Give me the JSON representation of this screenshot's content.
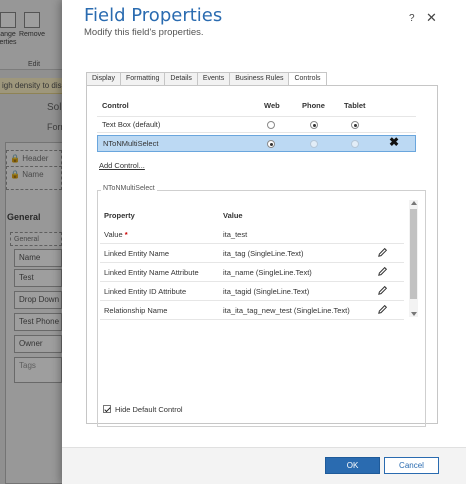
{
  "background": {
    "ribbon_buttons": [
      "ange\nerties",
      "Remove"
    ],
    "ribbon_group": "Edit",
    "warning": "igh density to disp",
    "title": "Solu",
    "subtitle": "Forr",
    "header_section": "Header",
    "header_field": "Name",
    "general": "General",
    "general_sub": "General",
    "fields": [
      "Name",
      "Test",
      "Drop Down",
      "Test Phone",
      "Owner"
    ],
    "tags": "Tags"
  },
  "dialog": {
    "title": "Field Properties",
    "subtitle": "Modify this field's properties.",
    "help": "?",
    "close": "✕"
  },
  "tabs": [
    "Display",
    "Formatting",
    "Details",
    "Events",
    "Business Rules",
    "Controls"
  ],
  "controls": {
    "headers": {
      "control": "Control",
      "web": "Web",
      "phone": "Phone",
      "tablet": "Tablet"
    },
    "rows": [
      {
        "name": "Text Box (default)",
        "web": false,
        "phone": true,
        "tablet": true
      },
      {
        "name": "NToNMultiSelect",
        "web": true,
        "phone": false,
        "tablet": false
      }
    ],
    "remove": "✖",
    "add_control": "Add Control..."
  },
  "group": {
    "title": "NToNMultiSelect",
    "headers": {
      "property": "Property",
      "value": "Value"
    },
    "rows": [
      {
        "property": "Value",
        "required": "*",
        "value": "ita_test"
      },
      {
        "property": "Linked Entity Name",
        "value": "ita_tag (SingleLine.Text)"
      },
      {
        "property": "Linked Entity Name Attribute",
        "value": "ita_name (SingleLine.Text)"
      },
      {
        "property": "Linked Entity ID Attribute",
        "value": "ita_tagid (SingleLine.Text)"
      },
      {
        "property": "Relationship Name",
        "value": "ita_ita_tag_new_test (SingleLine.Text)"
      }
    ],
    "hide_default": "Hide Default Control"
  },
  "footer": {
    "ok": "OK",
    "cancel": "Cancel"
  },
  "colors": {
    "accent": "#2a6bb0",
    "selected_row": "#bcd9f3"
  }
}
